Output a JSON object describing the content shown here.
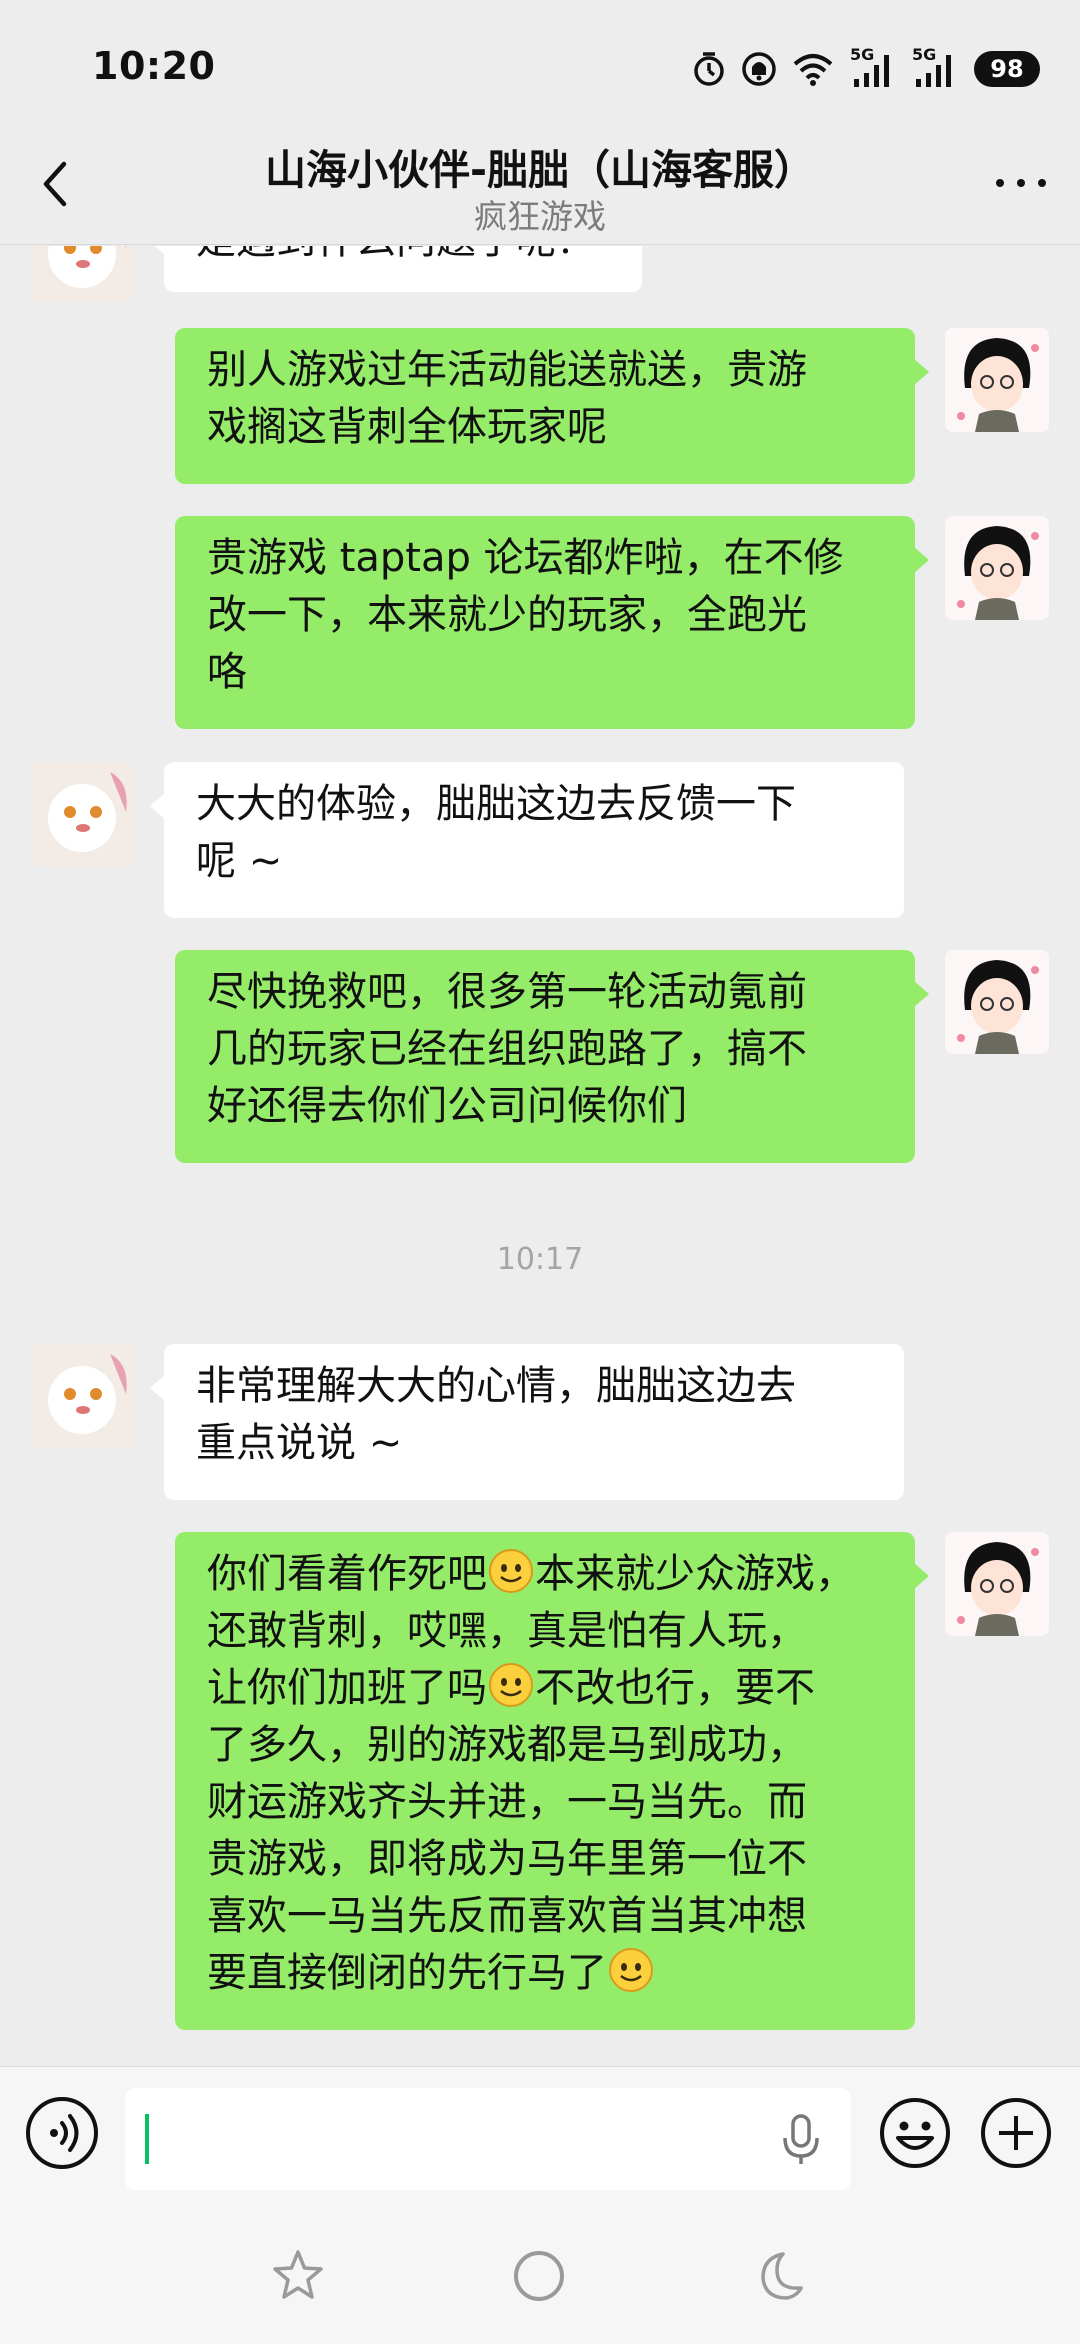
{
  "status_bar": {
    "time": "10:20",
    "battery": "98",
    "network_label_1": "5G",
    "network_label_2": "5G",
    "icons": [
      "alarm-icon",
      "notification-bell-icon",
      "wifi-icon",
      "signal-5g-icon",
      "signal-5g-icon",
      "battery-icon"
    ]
  },
  "header": {
    "title": "山海小伙伴-朏朏（山海客服）",
    "subtitle": "疯狂游戏",
    "back_icon": "chevron-left-icon",
    "more_icon": "more-dots-icon"
  },
  "messages": [
    {
      "side": "in",
      "lines": [
        "是遇到什么问题了呢？"
      ],
      "partial": true
    },
    {
      "side": "out",
      "lines": [
        "别人游戏过年活动能送就送，贵游",
        "戏搁这背刺全体玩家呢"
      ]
    },
    {
      "side": "out",
      "lines": [
        "贵游戏 taptap 论坛都炸啦，在不修",
        "改一下，本来就少的玩家，全跑光",
        "咯"
      ]
    },
    {
      "side": "in",
      "lines": [
        "大大的体验，朏朏这边去反馈一下",
        "呢 ~"
      ]
    },
    {
      "side": "out",
      "lines": [
        "尽快挽救吧，很多第一轮活动氪前",
        "几的玩家已经在组织跑路了，搞不",
        "好还得去你们公司问候你们"
      ]
    },
    {
      "side": "in",
      "lines": [
        "非常理解大大的心情，朏朏这边去",
        "重点说说 ~"
      ]
    },
    {
      "side": "out",
      "lines": [
        "你们看着作死吧",
        "本来就少众游戏，",
        "还敢背刺，哎嘿，真是怕有人玩，",
        "让你们加班了吗",
        "不改也行，要不",
        "了多久，别的游戏都是马到成功，",
        "财运游戏齐头并进，一马当先。而",
        "贵游戏，即将成为马年里第一位不",
        "喜欢一马当先反而喜欢首当其冲想",
        "要直接倒闭的先行马了"
      ]
    }
  ],
  "timestamp": "10:17",
  "input_bar": {
    "voice_icon": "voice-input-icon",
    "mic_icon": "microphone-icon",
    "emoji_icon": "emoji-icon",
    "plus_icon": "plus-circle-icon",
    "value": ""
  },
  "system_nav": {
    "icons": [
      "star-icon",
      "home-circle-icon",
      "moon-icon"
    ]
  },
  "colors": {
    "background": "#ededed",
    "outgoing_bubble": "#95ec69",
    "incoming_bubble": "#ffffff",
    "caret": "#07c160"
  }
}
